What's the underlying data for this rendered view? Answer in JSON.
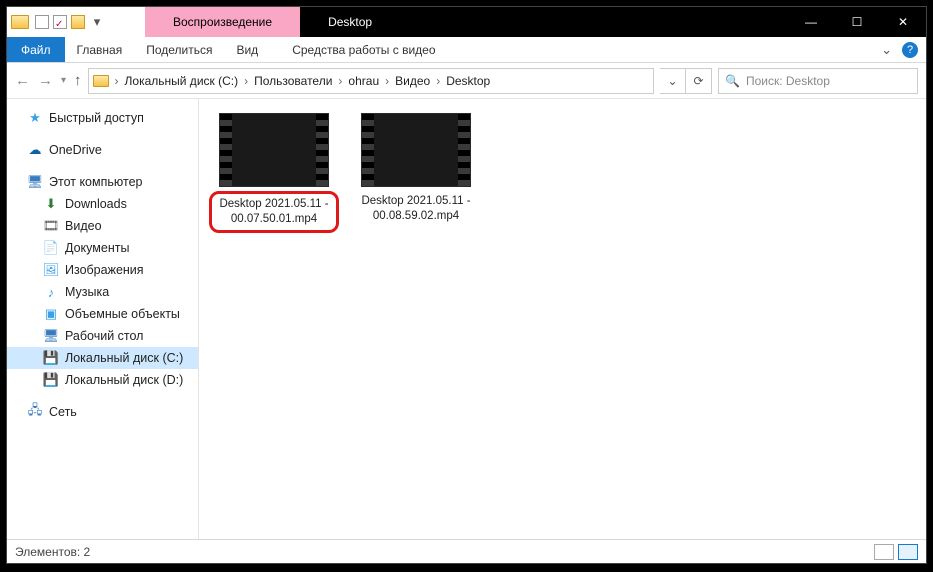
{
  "titlebar": {
    "context_tab": "Воспроизведение",
    "title": "Desktop"
  },
  "ribbon": {
    "file": "Файл",
    "tabs": [
      "Главная",
      "Поделиться",
      "Вид"
    ],
    "tools": "Средства работы с видео"
  },
  "nav": {
    "segments": [
      "Локальный диск (C:)",
      "Пользователи",
      "ohrau",
      "Видео",
      "Desktop"
    ],
    "search_placeholder": "Поиск: Desktop"
  },
  "sidebar": {
    "quick": "Быстрый доступ",
    "onedrive": "OneDrive",
    "thispc": "Этот компьютер",
    "thispc_items": [
      "Downloads",
      "Видео",
      "Документы",
      "Изображения",
      "Музыка",
      "Объемные объекты",
      "Рабочий стол",
      "Локальный диск (C:)",
      "Локальный диск (D:)"
    ],
    "network": "Сеть"
  },
  "files": [
    {
      "name": "Desktop 2021.05.11 - 00.07.50.01.mp4",
      "highlighted": true
    },
    {
      "name": "Desktop 2021.05.11 - 00.08.59.02.mp4",
      "highlighted": false
    }
  ],
  "status": {
    "items_label": "Элементов: 2"
  }
}
